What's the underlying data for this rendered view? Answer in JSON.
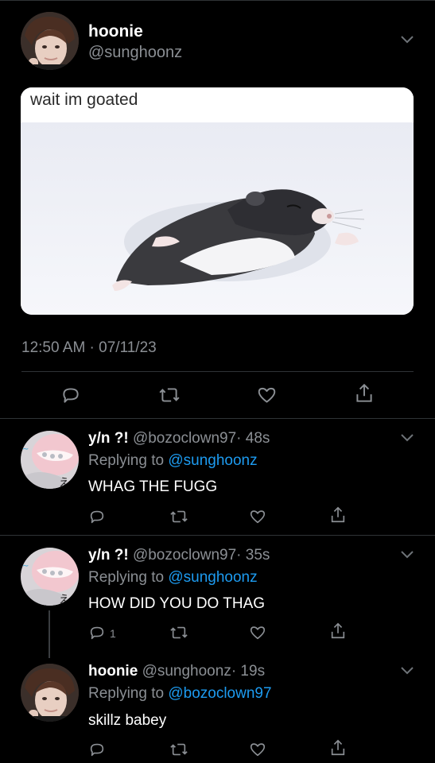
{
  "main_tweet": {
    "display_name": "hoonie",
    "handle": "@sunghoonz",
    "image_caption": "wait im goated",
    "image_alt": "hamster running",
    "timestamp": "12:50 AM · 07/11/23"
  },
  "replies": [
    {
      "display_name": "y/n ?!",
      "handle": "@bozoclown97",
      "time": "· 48s",
      "replying_prefix": "Replying to",
      "replying_to": "@sunghoonz",
      "text": "WHAG THE FUGG",
      "reply_count": ""
    },
    {
      "display_name": "y/n ?!",
      "handle": "@bozoclown97",
      "time": "· 35s",
      "replying_prefix": "Replying to",
      "replying_to": "@sunghoonz",
      "text": "HOW DID YOU DO THAG",
      "reply_count": "1"
    },
    {
      "display_name": "hoonie",
      "handle": "@sunghoonz",
      "time": "· 19s",
      "replying_prefix": "Replying to",
      "replying_to": "@bozoclown97",
      "text": "skillz babey",
      "reply_count": ""
    }
  ],
  "icons": [
    "reply-icon",
    "retweet-icon",
    "like-icon",
    "share-icon",
    "chevron-down-icon"
  ],
  "colors": {
    "background": "#000000",
    "link": "#1d9bf0",
    "muted": "#8b8f94",
    "divider": "#2f3336"
  }
}
